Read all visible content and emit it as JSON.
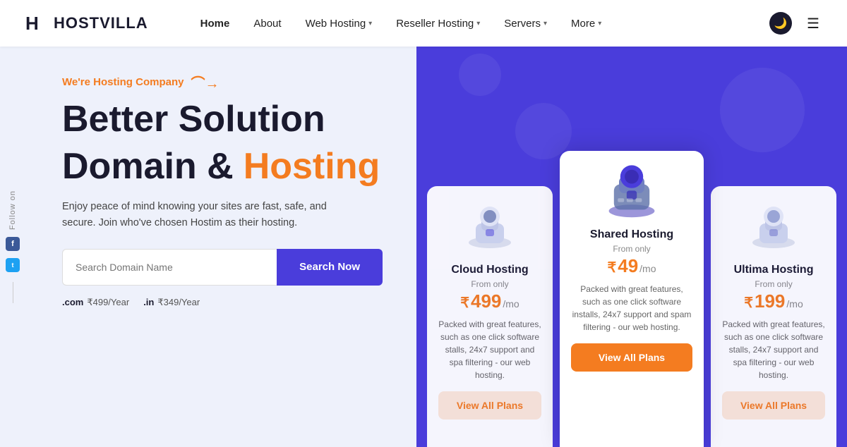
{
  "brand": {
    "name": "HOSTVILLA",
    "logo_text": "H"
  },
  "nav": {
    "links": [
      {
        "label": "Home",
        "has_dropdown": false,
        "active": true
      },
      {
        "label": "About",
        "has_dropdown": false,
        "active": false
      },
      {
        "label": "Web Hosting",
        "has_dropdown": true,
        "active": false
      },
      {
        "label": "Reseller Hosting",
        "has_dropdown": true,
        "active": false
      },
      {
        "label": "Servers",
        "has_dropdown": true,
        "active": false
      },
      {
        "label": "More",
        "has_dropdown": true,
        "active": false
      }
    ]
  },
  "hero": {
    "tagline": "We're Hosting Company",
    "title_line1": "Better Solution",
    "title_line2_plain": "Domain &",
    "title_line2_colored": "Hosting",
    "description": "Enjoy peace of mind knowing your sites are fast, safe, and secure. Join who've chosen Hostim as their hosting.",
    "search_placeholder": "Search Domain Name",
    "search_button": "Search Now",
    "domain_prices": [
      {
        "ext": ".com",
        "price": "₹499/Year"
      },
      {
        "ext": ".in",
        "price": "₹349/Year"
      }
    ]
  },
  "follow": {
    "label": "Follow on"
  },
  "cards": [
    {
      "id": "cloud",
      "title": "Cloud Hosting",
      "from_label": "From only",
      "price": "₹499",
      "per_mo": "/mo",
      "description": "Packed with great features, such as one click software stalls, 24x7 support and spa filtering - our web hosting.",
      "btn_label": "View All Plans",
      "featured": false
    },
    {
      "id": "shared",
      "title": "Shared Hosting",
      "from_label": "From only",
      "price": "₹49",
      "per_mo": "/mo",
      "description": "Packed with great features, such as one click software installs, 24x7 support and spam filtering - our web hosting.",
      "btn_label": "View All Plans",
      "featured": true
    },
    {
      "id": "ultima",
      "title": "Ultima Hosting",
      "from_label": "From only",
      "price": "₹199",
      "per_mo": "/mo",
      "description": "Packed with great features, such as one click software stalls, 24x7 support and spa filtering - our web hosting.",
      "btn_label": "View All Plans",
      "featured": false
    }
  ]
}
